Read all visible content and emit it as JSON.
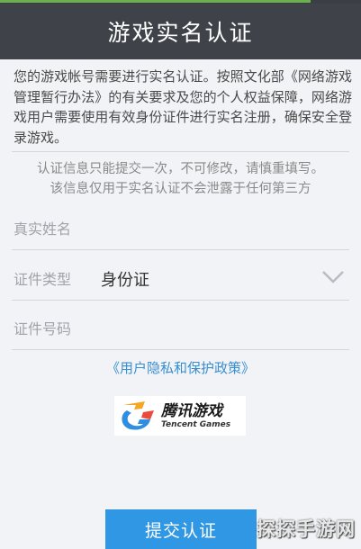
{
  "header": {
    "title": "游戏实名认证"
  },
  "notice": "您的游戏帐号需要进行实名认证。按照文化部《网络游戏管理暂行办法》的有关要求及您的个人权益保障，网络游戏用户需要使用有效身份证件进行实名注册，确保安全登录游戏。",
  "warning": {
    "line1": "认证信息只能提交一次，不可修改，请慎重填写。",
    "line2": "该信息仅用于实名认证不会泄露于任何第三方"
  },
  "form": {
    "name_placeholder": "真实姓名",
    "id_type_label": "证件类型",
    "id_type_value": "身份证",
    "id_number_placeholder": "证件号码"
  },
  "privacy_link": "《用户隐私和保护政策》",
  "logo": {
    "cn": "腾讯游戏",
    "en": "Tencent Games"
  },
  "submit_label": "提交认证",
  "watermark": "探探手游网",
  "colors": {
    "header_bg": "#3f4349",
    "accent_green": "#6ab04c",
    "button_bg": "#2f97e4",
    "link": "#3a8fd0",
    "background": "#f1f3f6"
  },
  "icons": [
    "chevron-down-icon",
    "tencent-games-logo"
  ]
}
